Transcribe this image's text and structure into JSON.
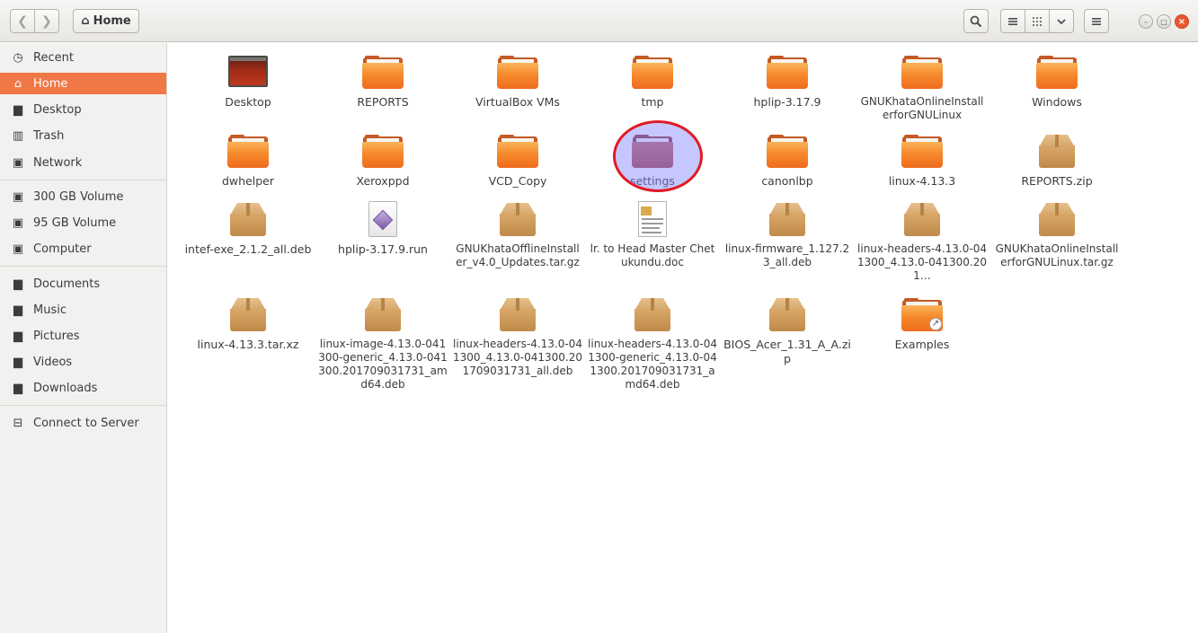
{
  "header": {
    "back_icon": "chevron-left-icon",
    "forward_icon": "chevron-right-icon",
    "location_label": "Home",
    "location_icon": "home-icon",
    "search_icon": "search-icon",
    "list_view_icon": "list-view-icon",
    "grid_view_icon": "grid-view-icon",
    "view_options_icon": "chevron-down-icon",
    "menu_icon": "hamburger-menu-icon",
    "window_controls": [
      "minimize",
      "maximize",
      "close"
    ]
  },
  "sidebar": {
    "items": [
      {
        "label": "Recent",
        "icon": "clock-icon",
        "glyph": "◷"
      },
      {
        "label": "Home",
        "icon": "home-icon",
        "glyph": "⌂",
        "active": true
      },
      {
        "label": "Desktop",
        "icon": "folder-icon",
        "glyph": "▆"
      },
      {
        "label": "Trash",
        "icon": "trash-icon",
        "glyph": "▥"
      },
      {
        "label": "Network",
        "icon": "network-icon",
        "glyph": "▣"
      },
      {
        "label": "300 GB Volume",
        "icon": "drive-icon",
        "glyph": "▣"
      },
      {
        "label": "95 GB Volume",
        "icon": "drive-icon",
        "glyph": "▣"
      },
      {
        "label": "Computer",
        "icon": "computer-icon",
        "glyph": "▣"
      },
      {
        "label": "Documents",
        "icon": "folder-icon",
        "glyph": "▆"
      },
      {
        "label": "Music",
        "icon": "folder-icon",
        "glyph": "▆"
      },
      {
        "label": "Pictures",
        "icon": "folder-icon",
        "glyph": "▆"
      },
      {
        "label": "Videos",
        "icon": "folder-icon",
        "glyph": "▆"
      },
      {
        "label": "Downloads",
        "icon": "folder-icon",
        "glyph": "▆"
      },
      {
        "label": "Connect to Server",
        "icon": "server-icon",
        "glyph": "⊟"
      }
    ]
  },
  "files": [
    {
      "name": "Desktop",
      "type": "desktop"
    },
    {
      "name": "REPORTS",
      "type": "folder"
    },
    {
      "name": "VirtualBox VMs",
      "type": "folder"
    },
    {
      "name": "tmp",
      "type": "folder"
    },
    {
      "name": "hplip-3.17.9",
      "type": "folder"
    },
    {
      "name": "GNUKhataOnlineInstallerforGNULinux",
      "type": "folder"
    },
    {
      "name": "Windows",
      "type": "folder"
    },
    {
      "name": "dwhelper",
      "type": "folder"
    },
    {
      "name": "Xeroxppd",
      "type": "folder"
    },
    {
      "name": "VCD_Copy",
      "type": "folder"
    },
    {
      "name": "settings",
      "type": "folder",
      "highlighted": true
    },
    {
      "name": "canonlbp",
      "type": "folder"
    },
    {
      "name": "linux-4.13.3",
      "type": "folder"
    },
    {
      "name": "REPORTS.zip",
      "type": "archive"
    },
    {
      "name": "intef-exe_2.1.2_all.deb",
      "type": "archive"
    },
    {
      "name": "hplip-3.17.9.run",
      "type": "script"
    },
    {
      "name": "GNUKhataOfflineInstaller_v4.0_Updates.tar.gz",
      "type": "archive"
    },
    {
      "name": "lr. to  Head Master Chetukundu.doc",
      "type": "document"
    },
    {
      "name": "linux-firmware_1.127.23_all.deb",
      "type": "archive"
    },
    {
      "name": "linux-headers-4.13.0-041300_4.13.0-041300.201…",
      "type": "archive"
    },
    {
      "name": "GNUKhataOnlineInstallerforGNULinux.tar.gz",
      "type": "archive"
    },
    {
      "name": "linux-4.13.3.tar.xz",
      "type": "archive"
    },
    {
      "name": "linux-image-4.13.0-041300-generic_4.13.0-041300.201709031731_amd64.deb",
      "type": "archive"
    },
    {
      "name": "linux-headers-4.13.0-041300_4.13.0-041300.201709031731_all.deb",
      "type": "archive"
    },
    {
      "name": "linux-headers-4.13.0-041300-generic_4.13.0-041300.201709031731_amd64.deb",
      "type": "archive"
    },
    {
      "name": "BIOS_Acer_1.31_A_A.zip",
      "type": "archive"
    },
    {
      "name": "Examples",
      "type": "link-folder"
    }
  ],
  "colors": {
    "accent": "#f07746",
    "folder_orange": "#f58a2c",
    "highlight_ring": "#e01b24",
    "highlight_fill": "#8282ff"
  }
}
